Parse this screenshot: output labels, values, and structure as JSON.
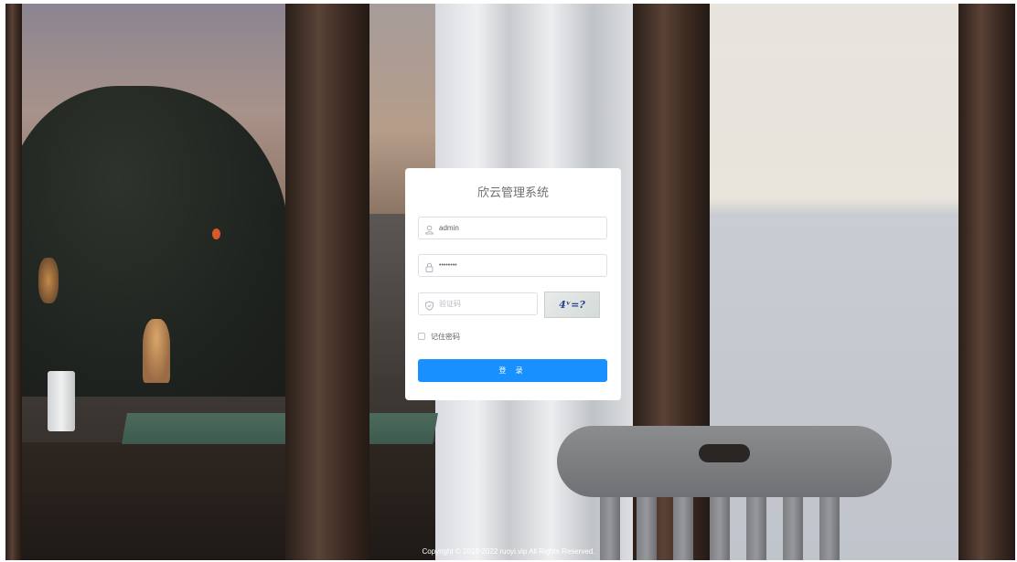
{
  "login": {
    "title": "欣云管理系统",
    "username_value": "admin",
    "password_value": "••••••••",
    "captcha_placeholder": "验证码",
    "captcha_text": "4ᵛ=?",
    "remember_label": "记住密码",
    "login_button": "登 录"
  },
  "footer": {
    "copyright": "Copyright © 2018-2022 ruoyi.vip All Rights Reserved."
  },
  "colors": {
    "primary_button": "#1890ff",
    "card_background": "#ffffff"
  },
  "icons": {
    "username": "user-icon",
    "password": "lock-icon",
    "captcha": "shield-icon"
  }
}
